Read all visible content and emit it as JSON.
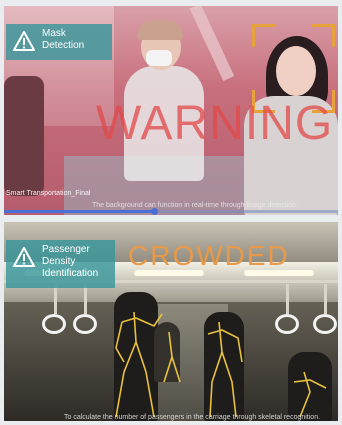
{
  "panels": {
    "mask": {
      "badge_label": "Mask Detection",
      "warning_text": "WARNING",
      "file_label": "Smart Transportation_Final",
      "caption": "The background can function in real-time through image detection.",
      "progress_fraction": 0.45
    },
    "crowd": {
      "badge_label": "Passenger Density Identification",
      "status_text": "CROWDED",
      "caption": "To calculate the number of passengers in the carriage through skeletal recognition."
    }
  },
  "colors": {
    "badge": "#38969b",
    "warning": "#e24848",
    "crowded": "#e89a4a",
    "skeleton": "#e8c23c",
    "focus_bracket": "#e8a23c"
  },
  "icons": {
    "warning": "warning-triangle-icon"
  }
}
